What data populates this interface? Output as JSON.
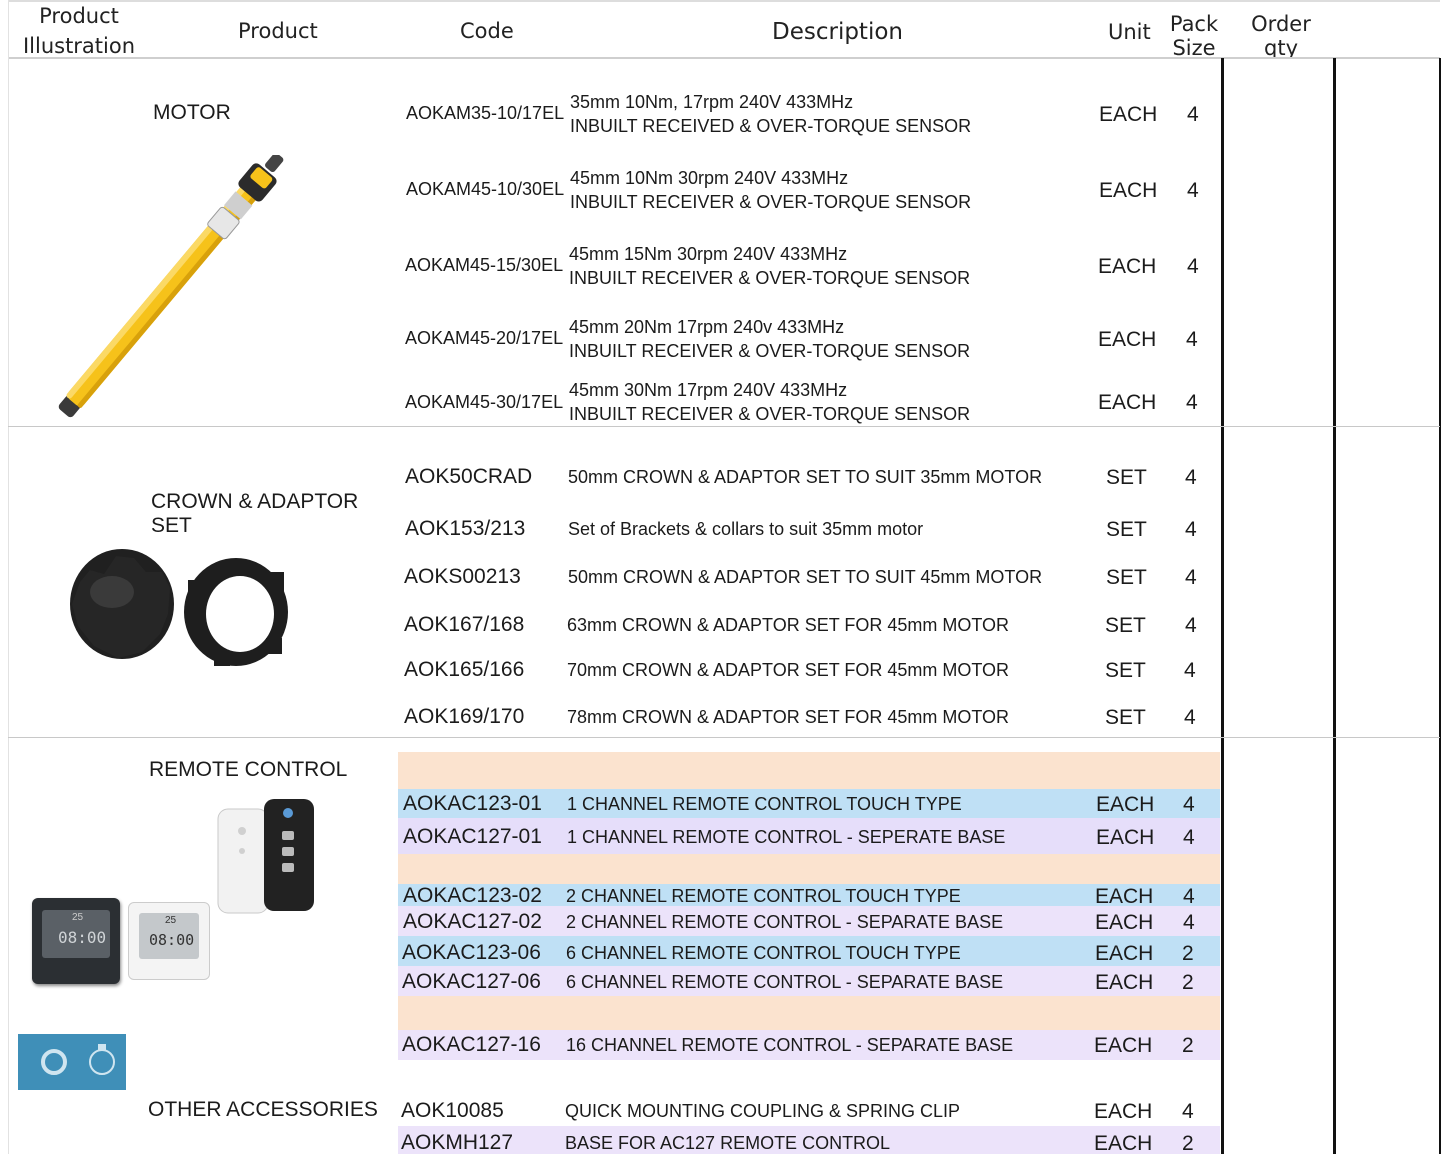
{
  "headers": {
    "illustration": [
      "Product",
      "Illustration"
    ],
    "product": "Product",
    "code": "Code",
    "description": "Description",
    "unit": "Unit",
    "pack_size": [
      "Pack",
      "Size"
    ],
    "order_qty": [
      "Order",
      "qty"
    ]
  },
  "sections": {
    "motor": {
      "title": "MOTOR",
      "rows": [
        {
          "code": "AOKAM35-10/17EL",
          "desc1": "35mm 10Nm, 17rpm 240V 433MHz",
          "desc2": "INBUILT RECEIVED & OVER-TORQUE SENSOR",
          "unit": "EACH",
          "pack": "4"
        },
        {
          "code": "AOKAM45-10/30EL",
          "desc1": "45mm 10Nm 30rpm 240V 433MHz",
          "desc2": "INBUILT RECEIVER & OVER-TORQUE SENSOR",
          "unit": "EACH",
          "pack": "4"
        },
        {
          "code": "AOKAM45-15/30EL",
          "desc1": "45mm 15Nm 30rpm 240V 433MHz",
          "desc2": "INBUILT RECEIVER & OVER-TORQUE SENSOR",
          "unit": "EACH",
          "pack": "4"
        },
        {
          "code": "AOKAM45-20/17EL",
          "desc1": "45mm 20Nm 17rpm 240v 433MHz",
          "desc2": "INBUILT RECEIVER & OVER-TORQUE SENSOR",
          "unit": "EACH",
          "pack": "4"
        },
        {
          "code": "AOKAM45-30/17EL",
          "desc1": "45mm 30Nm 17rpm 240V 433MHz",
          "desc2": "INBUILT RECEIVER & OVER-TORQUE SENSOR",
          "unit": "EACH",
          "pack": "4"
        }
      ]
    },
    "crown": {
      "title1": "CROWN & ADAPTOR",
      "title2": "SET",
      "rows": [
        {
          "code": "AOK50CRAD",
          "desc": "50mm CROWN & ADAPTOR SET TO SUIT 35mm MOTOR",
          "unit": "SET",
          "pack": "4"
        },
        {
          "code": "AOK153/213",
          "desc": "Set of Brackets & collars to suit 35mm motor",
          "unit": "SET",
          "pack": "4"
        },
        {
          "code": "AOKS00213",
          "desc": "50mm CROWN & ADAPTOR SET TO SUIT 45mm MOTOR",
          "unit": "SET",
          "pack": "4"
        },
        {
          "code": "AOK167/168",
          "desc": "63mm CROWN & ADAPTOR SET FOR 45mm MOTOR",
          "unit": "SET",
          "pack": "4"
        },
        {
          "code": "AOK165/166",
          "desc": "70mm CROWN & ADAPTOR SET FOR 45mm MOTOR",
          "unit": "SET",
          "pack": "4"
        },
        {
          "code": "AOK169/170",
          "desc": "78mm CROWN & ADAPTOR SET FOR 45mm MOTOR",
          "unit": "SET",
          "pack": "4"
        }
      ]
    },
    "remote": {
      "title": "REMOTE CONTROL",
      "rows": [
        {
          "code": "AOKAC123-01",
          "desc": "1 CHANNEL REMOTE CONTROL TOUCH TYPE",
          "unit": "EACH",
          "pack": "4"
        },
        {
          "code": "AOKAC127-01",
          "desc": "1 CHANNEL REMOTE CONTROL - SEPERATE BASE",
          "unit": "EACH",
          "pack": "4"
        },
        {
          "code": "AOKAC123-02",
          "desc": "2 CHANNEL REMOTE CONTROL TOUCH TYPE",
          "unit": "EACH",
          "pack": "4"
        },
        {
          "code": "AOKAC127-02",
          "desc": "2 CHANNEL REMOTE CONTROL - SEPARATE BASE",
          "unit": "EACH",
          "pack": "4"
        },
        {
          "code": "AOKAC123-06",
          "desc": "6 CHANNEL REMOTE CONTROL TOUCH TYPE",
          "unit": "EACH",
          "pack": "2"
        },
        {
          "code": "AOKAC127-06",
          "desc": "6 CHANNEL REMOTE CONTROL - SEPARATE BASE",
          "unit": "EACH",
          "pack": "2"
        },
        {
          "code": "AOKAC127-16",
          "desc": "16 CHANNEL REMOTE CONTROL - SEPARATE BASE",
          "unit": "EACH",
          "pack": "2"
        }
      ],
      "timer_display": "08:00",
      "timer_small": "25"
    },
    "accessories": {
      "title": "OTHER ACCESSORIES",
      "rows": [
        {
          "code": "AOK10085",
          "desc": "QUICK MOUNTING COUPLING & SPRING CLIP",
          "unit": "EACH",
          "pack": "4"
        },
        {
          "code": "AOKMH127",
          "desc": "BASE FOR AC127 REMOTE CONTROL",
          "unit": "EACH",
          "pack": "2"
        }
      ]
    }
  },
  "colors": {
    "band_peach": "#fbe3cf",
    "band_blue": "#bfe0f5",
    "band_lavender": "#e6defa",
    "motor_yellow": "#f5c518"
  }
}
